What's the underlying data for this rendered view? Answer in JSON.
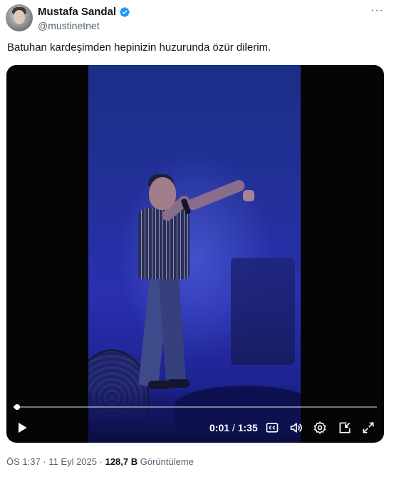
{
  "author": {
    "name": "Mustafa Sandal",
    "handle": "@mustinetnet",
    "verified_icon": "verified-badge-icon",
    "verified_color": "#1d9bf0"
  },
  "more_icon_label": "···",
  "tweet": {
    "text": "Batuhan kardeşimden hepinizin huzurunda özür dilerim."
  },
  "video": {
    "progress": 0.01,
    "current_time": "0:01",
    "separator": "/",
    "duration": "1:35",
    "icons": [
      "play-icon",
      "captions-icon",
      "volume-icon",
      "settings-icon",
      "pip-icon",
      "fullscreen-icon"
    ]
  },
  "meta": {
    "time": "ÖS 1:37",
    "dot1": "·",
    "date": "11 Eyl 2025",
    "dot2": "·",
    "views_count": "128,7 B",
    "views_label": "Görüntüleme"
  },
  "colors": {
    "text_primary": "#0f1419",
    "text_secondary": "#536471",
    "stage_blue": "#2a2fb0"
  }
}
